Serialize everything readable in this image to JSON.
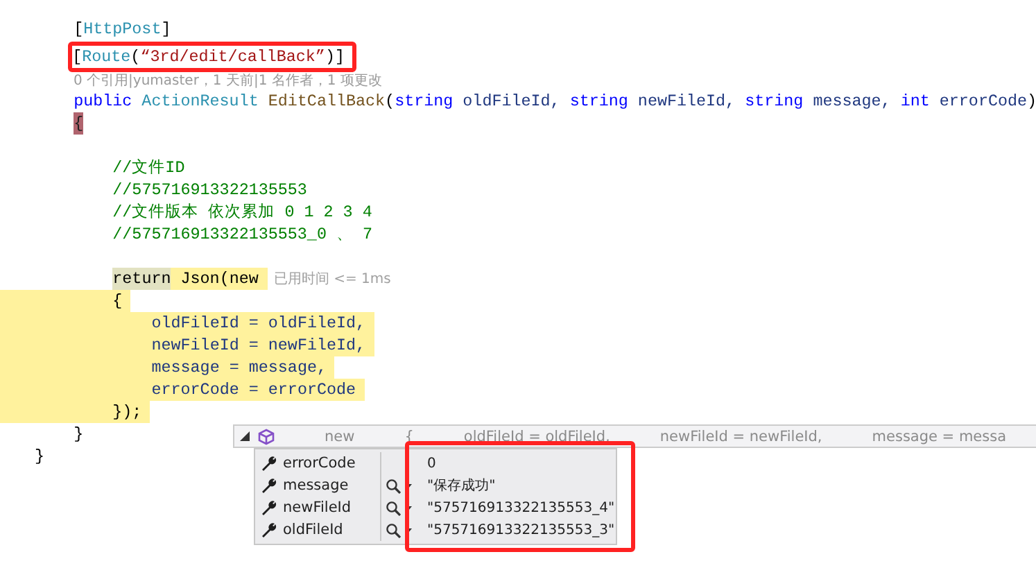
{
  "editor": {
    "lines": [
      {
        "kind": "code",
        "highlighted": false,
        "boxed": false,
        "tokens": [
          {
            "kind": "plain",
            "text": "["
          },
          {
            "kind": "type",
            "text": "HttpPost"
          },
          {
            "kind": "plain",
            "text": "]"
          }
        ]
      },
      {
        "kind": "code",
        "highlighted": false,
        "boxed": true,
        "tokens": [
          {
            "kind": "plain",
            "text": "["
          },
          {
            "kind": "type",
            "text": "Route"
          },
          {
            "kind": "plain",
            "text": "("
          },
          {
            "kind": "string",
            "text": "“3rd/edit/callBack”"
          },
          {
            "kind": "plain",
            "text": ")]"
          }
        ]
      },
      {
        "kind": "codelens",
        "text": "0 个引用|yumaster，1 天前|1 名作者，1 项更改"
      },
      {
        "kind": "code",
        "highlighted": false,
        "boxed": false,
        "tokens": [
          {
            "kind": "keyword",
            "text": "public"
          },
          {
            "kind": "type",
            "text": " ActionResult"
          },
          {
            "kind": "method",
            "text": " EditCallBack"
          },
          {
            "kind": "plain",
            "text": "("
          },
          {
            "kind": "keyword",
            "text": "string"
          },
          {
            "kind": "param",
            "text": " oldFileId, "
          },
          {
            "kind": "keyword",
            "text": "string"
          },
          {
            "kind": "param",
            "text": " newFileId, "
          },
          {
            "kind": "keyword",
            "text": "string"
          },
          {
            "kind": "param",
            "text": " message, "
          },
          {
            "kind": "keyword",
            "text": "int"
          },
          {
            "kind": "param",
            "text": " errorCode"
          },
          {
            "kind": "plain",
            "text": ")"
          }
        ]
      },
      {
        "kind": "code",
        "highlighted": false,
        "boxed": false,
        "tokens": [
          {
            "kind": "brace-match",
            "text": "{"
          }
        ],
        "children": [
          {
            "kind": "blank"
          },
          {
            "kind": "code",
            "highlighted": false,
            "boxed": false,
            "tokens": [
              {
                "kind": "comment",
                "text": "//文件ID"
              }
            ]
          },
          {
            "kind": "code",
            "highlighted": false,
            "boxed": false,
            "tokens": [
              {
                "kind": "comment",
                "text": "//575716913322135553"
              }
            ]
          },
          {
            "kind": "code",
            "highlighted": false,
            "boxed": false,
            "tokens": [
              {
                "kind": "comment",
                "text": "//文件版本 依次累加 0 1 2 3 4"
              }
            ]
          },
          {
            "kind": "code",
            "highlighted": false,
            "boxed": false,
            "tokens": [
              {
                "kind": "comment",
                "text": "//575716913322135553_0 、 7"
              }
            ]
          },
          {
            "kind": "blank"
          },
          {
            "kind": "code",
            "highlighted": false,
            "boxed": false,
            "hint": "已用时间 <= 1ms",
            "tokens": [
              {
                "kind": "step",
                "text": "return"
              },
              {
                "kind": "call",
                "text": " Json(new "
              }
            ]
          },
          {
            "kind": "code",
            "highlighted": true,
            "boxed": false,
            "tokens": [
              {
                "kind": "plain",
                "text": "{"
              }
            ],
            "children": [
              {
                "kind": "code",
                "highlighted": true,
                "boxed": false,
                "tokens": [
                  {
                    "kind": "param",
                    "text": "oldFileId = oldFileId,"
                  }
                ]
              },
              {
                "kind": "code",
                "highlighted": true,
                "boxed": false,
                "tokens": [
                  {
                    "kind": "param",
                    "text": "newFileId = newFileId,"
                  }
                ]
              },
              {
                "kind": "code",
                "highlighted": true,
                "boxed": false,
                "tokens": [
                  {
                    "kind": "param",
                    "text": "message = message,"
                  }
                ]
              },
              {
                "kind": "code",
                "highlighted": true,
                "boxed": false,
                "tokens": [
                  {
                    "kind": "param",
                    "text": "errorCode = errorCode"
                  }
                ]
              }
            ]
          },
          {
            "kind": "code",
            "highlighted": true,
            "boxed": false,
            "tokens": [
              {
                "kind": "plain",
                "text": "});"
              }
            ]
          }
        ]
      },
      {
        "kind": "code",
        "highlighted": false,
        "boxed": false,
        "tokens": [
          {
            "kind": "plain",
            "text": "}"
          }
        ]
      }
    ],
    "closing_lines": [
      {
        "kind": "code",
        "highlighted": false,
        "boxed": false,
        "tokens": [
          {
            "kind": "plain",
            "text": "}"
          }
        ]
      }
    ]
  },
  "datatip": {
    "expanded": true,
    "header": [
      "new",
      "{",
      "oldFileId = oldFileId,",
      "newFileId = newFileId,",
      "message = messa"
    ],
    "values_boxed": true,
    "rows": [
      {
        "name": "errorCode",
        "value": "0",
        "visualizer": false
      },
      {
        "name": "message",
        "value": "\"保存成功\"",
        "visualizer": true
      },
      {
        "name": "newFileId",
        "value": "\"575716913322135553_4\"",
        "visualizer": true
      },
      {
        "name": "oldFileId",
        "value": "\"575716913322135553_3\"",
        "visualizer": true
      }
    ]
  }
}
